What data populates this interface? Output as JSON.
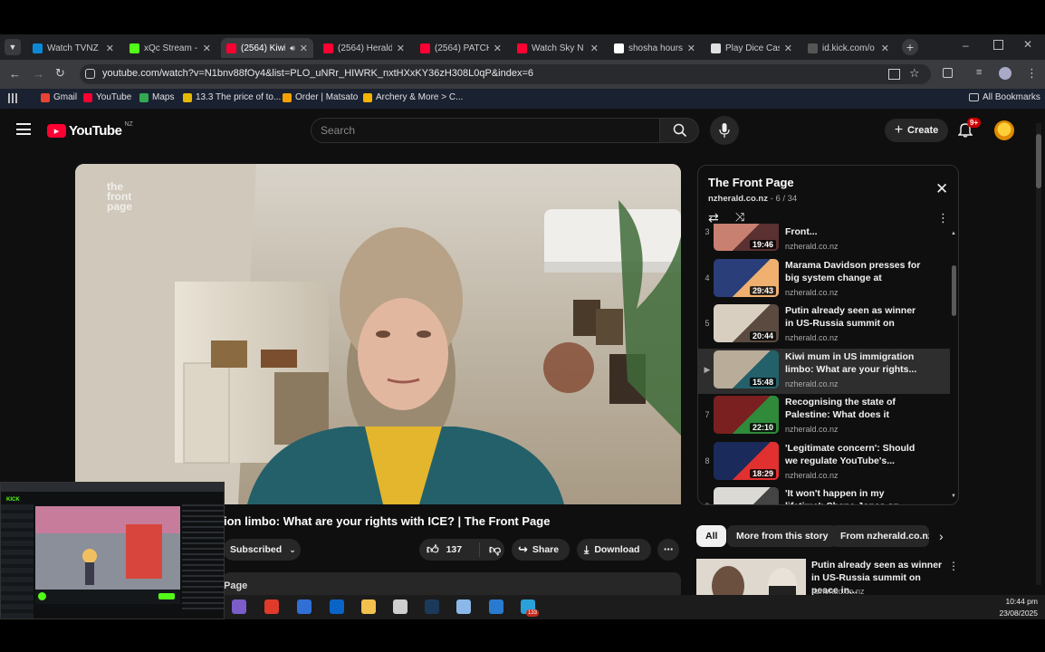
{
  "browser": {
    "tabs": [
      {
        "label": "Watch TVNZ",
        "color": "#0a8ad6",
        "active": false
      },
      {
        "label": "xQc Stream -",
        "color": "#53fc18",
        "active": false
      },
      {
        "label": "(2564) Kiwi",
        "color": "#ff0033",
        "active": true
      },
      {
        "label": "(2564) Herald",
        "color": "#ff0033",
        "active": false
      },
      {
        "label": "(2564) PATCH",
        "color": "#ff0033",
        "active": false
      },
      {
        "label": "Watch Sky N",
        "color": "#ff0033",
        "active": false
      },
      {
        "label": "shosha hours",
        "color": "#ffffff",
        "active": false
      },
      {
        "label": "Play Dice Casi",
        "color": "#e0e0e0",
        "active": false
      },
      {
        "label": "id.kick.com/o",
        "color": "#555555",
        "active": false
      }
    ],
    "url": "youtube.com/watch?v=N1bnv88fOy4&list=PLO_uNRr_HIWRK_nxtHXxKY36zH308L0qP&index=6",
    "bookmarks": [
      {
        "label": "Gmail",
        "color": "#ea4335"
      },
      {
        "label": "YouTube",
        "color": "#ff0033"
      },
      {
        "label": "Maps",
        "color": "#34a853"
      },
      {
        "label": "13.3 The price of to...",
        "color": "#e6b800"
      },
      {
        "label": "Order | Matsato",
        "color": "#f4a100"
      },
      {
        "label": "Archery & More > C...",
        "color": "#f4b400"
      }
    ],
    "all_bookmarks": "All Bookmarks"
  },
  "youtube": {
    "logo_text": "YouTube",
    "region": "NZ",
    "search_placeholder": "Search",
    "create_label": "Create",
    "notif_badge": "9+",
    "video": {
      "title_visible": "ion limbo: What are your rights with ICE? | The Front Page",
      "watermark": "the\nfront\npage",
      "subscribed_label": "Subscribed",
      "likes": "137",
      "share_label": "Share",
      "download_label": "Download",
      "below_snippet": "Page"
    },
    "playlist": {
      "title": "The Front Page",
      "channel": "nzherald.co.nz",
      "position": "6 / 34",
      "items": [
        {
          "index": "3",
          "title": "too late to pay off | The Front...",
          "channel": "nzherald.co.nz",
          "duration": "19:46"
        },
        {
          "index": "4",
          "title": "Marama Davidson presses for big system change at Oranga...",
          "channel": "nzherald.co.nz",
          "duration": "29:43"
        },
        {
          "index": "5",
          "title": "Putin already seen as winner in US-Russia summit on peace i...",
          "channel": "nzherald.co.nz",
          "duration": "20:44"
        },
        {
          "index": "▶",
          "title": "Kiwi mum in US immigration limbo: What are your rights...",
          "channel": "nzherald.co.nz",
          "duration": "15:48",
          "current": true
        },
        {
          "index": "7",
          "title": "Recognising the state of Palestine: What does it actual...",
          "channel": "nzherald.co.nz",
          "duration": "22:10"
        },
        {
          "index": "8",
          "title": "'Legitimate concern': Should we regulate YouTube's...",
          "channel": "nzherald.co.nz",
          "duration": "18:29"
        },
        {
          "index": "9",
          "title": "'It won't happen in my lifetime': Shane Jones on renewable...",
          "channel": "nzherald.co.nz",
          "duration": ""
        }
      ]
    },
    "chips": [
      "All",
      "More from this story",
      "From nzherald.co.nz"
    ],
    "recommendation": {
      "title": "Putin already seen as winner in US-Russia summit on peace in...",
      "channel": "nzherald.co.nz"
    }
  },
  "taskbar": {
    "time": "10:44 pm",
    "date": "23/08/2025",
    "badge": "133"
  },
  "overlay": {
    "app_label": "KICK"
  }
}
